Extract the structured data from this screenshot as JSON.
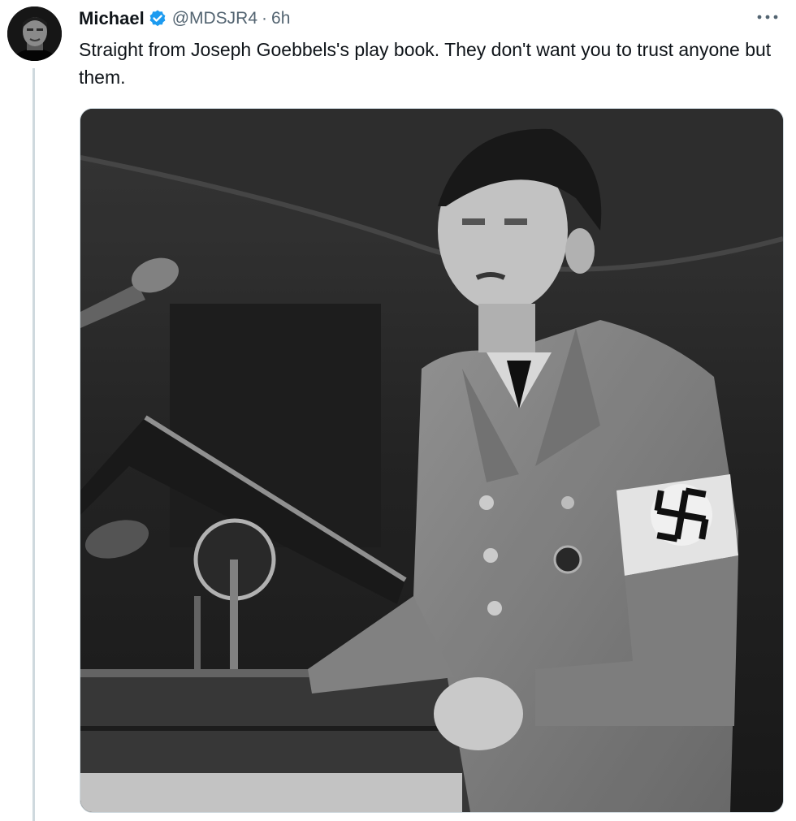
{
  "tweet": {
    "display_name": "Michael",
    "verified_icon": "verified-badge-icon",
    "handle": "@MDSJR4",
    "separator": "·",
    "timestamp": "6h",
    "more_icon": "more-options-icon",
    "text": "Straight from Joseph Goebbels's play book. They don't want you to trust anyone but them."
  },
  "media": {
    "kind": "black-and-white photograph",
    "subject": "uniformed speaker at podium with microphones"
  },
  "colors": {
    "text_primary": "#0f1419",
    "text_secondary": "#536471",
    "verified_blue": "#1d9bf0",
    "thread_line": "#cfd9de",
    "background": "#ffffff"
  }
}
